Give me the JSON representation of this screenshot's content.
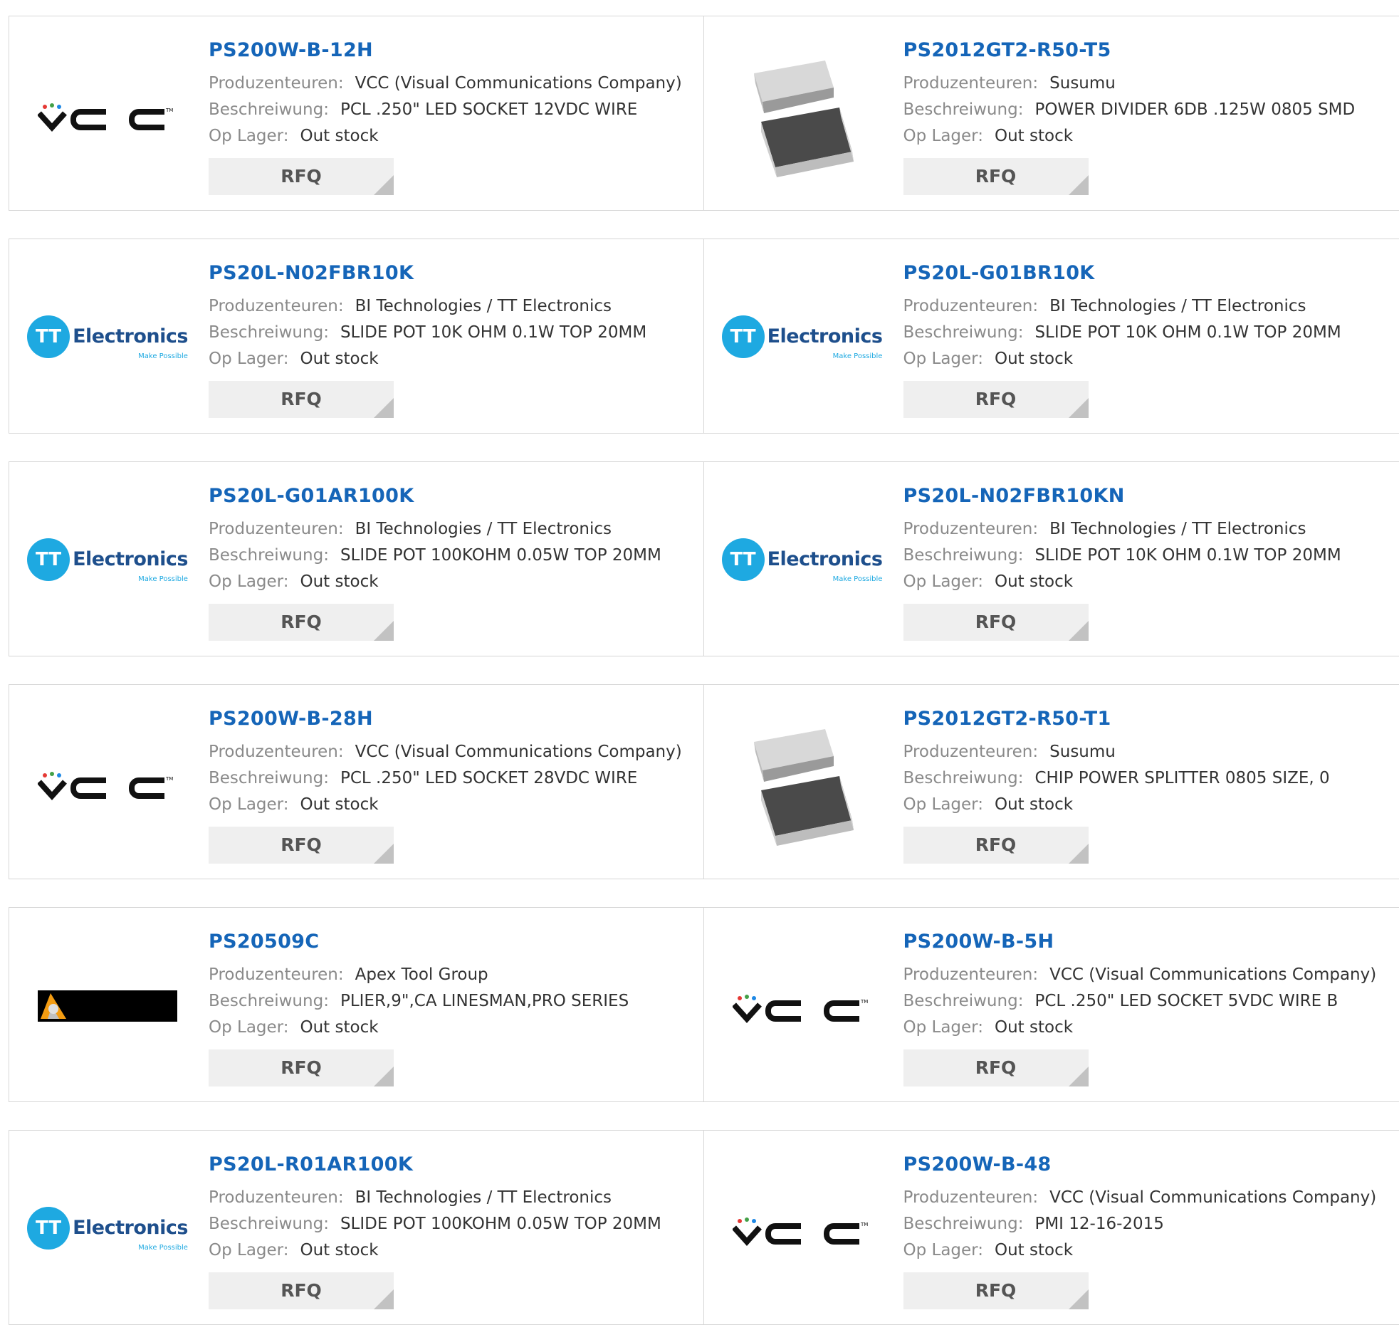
{
  "labels": {
    "manufacturer": "Produzenteuren:",
    "description": "Beschreiwung:",
    "stock": "Op Lager:",
    "rfq": "RFQ"
  },
  "colors": {
    "part_link": "#1565b8",
    "label": "#8a8a8a",
    "value": "#333333",
    "tt_blue": "#1ea9e1"
  },
  "logo_text": {
    "tt": "Electronics",
    "tt_tagline": "Make Possible",
    "tt_mark": "TT",
    "vcc": "VCC"
  },
  "products": [
    {
      "part": "PS200W-B-12H",
      "manufacturer": "VCC (Visual Communications Company)",
      "description": "PCL .250\" LED SOCKET 12VDC WIRE",
      "stock": "Out stock",
      "logo": "vcc"
    },
    {
      "part": "PS2012GT2-R50-T5",
      "manufacturer": "Susumu",
      "description": "POWER DIVIDER 6DB .125W 0805 SMD",
      "stock": "Out stock",
      "logo": "chip"
    },
    {
      "part": "PS20L-N02FBR10K",
      "manufacturer": "BI Technologies / TT Electronics",
      "description": "SLIDE POT 10K OHM 0.1W TOP 20MM",
      "stock": "Out stock",
      "logo": "tt"
    },
    {
      "part": "PS20L-G01BR10K",
      "manufacturer": "BI Technologies / TT Electronics",
      "description": "SLIDE POT 10K OHM 0.1W TOP 20MM",
      "stock": "Out stock",
      "logo": "tt"
    },
    {
      "part": "PS20L-G01AR100K",
      "manufacturer": "BI Technologies / TT Electronics",
      "description": "SLIDE POT 100KOHM 0.05W TOP 20MM",
      "stock": "Out stock",
      "logo": "tt"
    },
    {
      "part": "PS20L-N02FBR10KN",
      "manufacturer": "BI Technologies / TT Electronics",
      "description": "SLIDE POT 10K OHM 0.1W TOP 20MM",
      "stock": "Out stock",
      "logo": "tt"
    },
    {
      "part": "PS200W-B-28H",
      "manufacturer": "VCC (Visual Communications Company)",
      "description": "PCL .250\" LED SOCKET 28VDC WIRE",
      "stock": "Out stock",
      "logo": "vcc"
    },
    {
      "part": "PS2012GT2-R50-T1",
      "manufacturer": "Susumu",
      "description": "CHIP POWER SPLITTER 0805 SIZE, 0",
      "stock": "Out stock",
      "logo": "chip"
    },
    {
      "part": "PS20509C",
      "manufacturer": "Apex Tool Group",
      "description": "PLIER,9\",CA LINESMAN,PRO SERIES",
      "stock": "Out stock",
      "logo": "apex"
    },
    {
      "part": "PS200W-B-5H",
      "manufacturer": "VCC (Visual Communications Company)",
      "description": "PCL .250\" LED SOCKET 5VDC WIRE B",
      "stock": "Out stock",
      "logo": "vcc"
    },
    {
      "part": "PS20L-R01AR100K",
      "manufacturer": "BI Technologies / TT Electronics",
      "description": "SLIDE POT 100KOHM 0.05W TOP 20MM",
      "stock": "Out stock",
      "logo": "tt"
    },
    {
      "part": "PS200W-B-48",
      "manufacturer": "VCC (Visual Communications Company)",
      "description": "PMI 12-16-2015",
      "stock": "Out stock",
      "logo": "vcc"
    }
  ]
}
